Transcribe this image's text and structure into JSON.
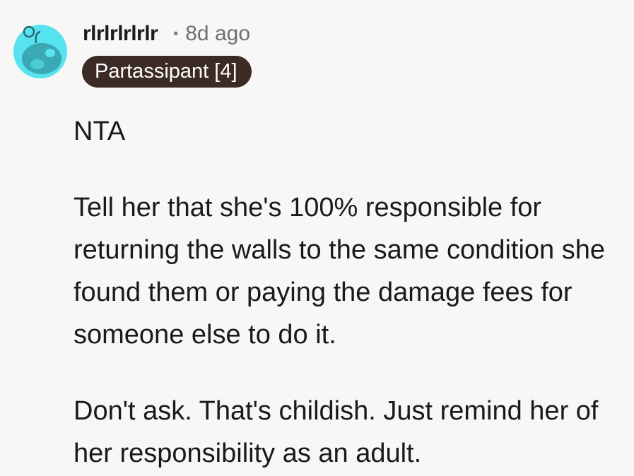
{
  "comment": {
    "author": "rlrlrlrlrlr",
    "separator": "•",
    "timestamp": "8d ago",
    "flair": "Partassipant [4]",
    "avatar_icon": "reddit-snoo-avatar-icon",
    "avatar_color": "#57e4f0",
    "flair_color": "#3b2b24",
    "paragraphs": [
      "NTA",
      "Tell her that she's 100% responsible for returning the walls to the same condition she found them or paying the damage fees for someone else to do it.",
      "Don't ask. That's childish. Just remind her of her responsibility as an adult."
    ]
  }
}
